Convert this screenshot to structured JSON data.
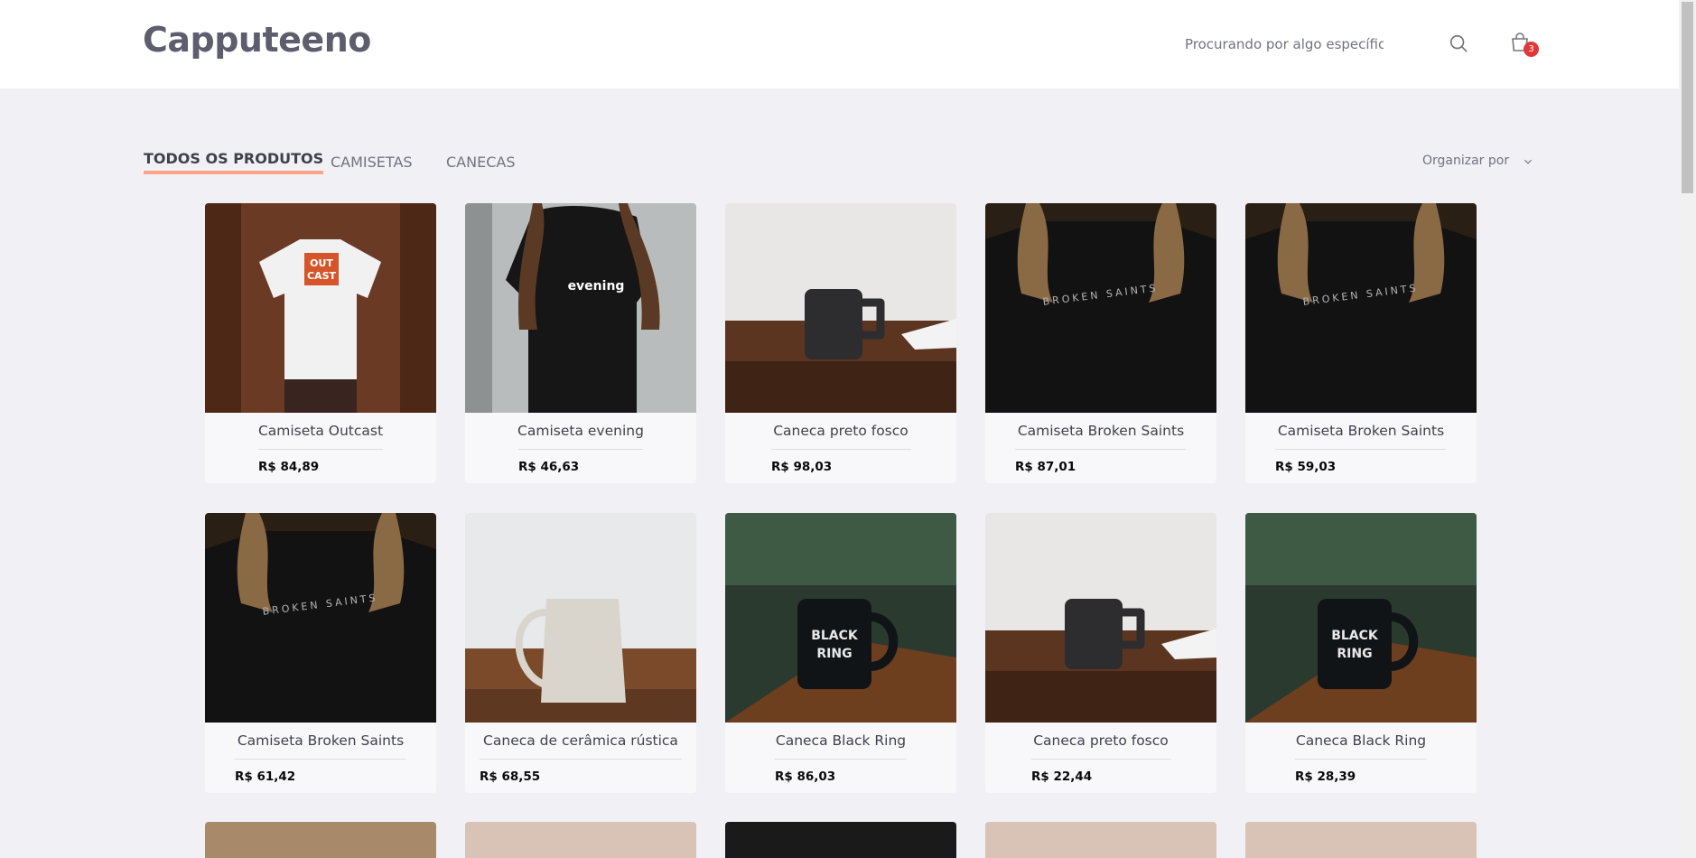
{
  "header": {
    "logo": "Capputeeno",
    "search_placeholder": "Procurando por algo específico?",
    "cart_count": "3"
  },
  "tabs": [
    {
      "label": "TODOS OS PRODUTOS",
      "active": true
    },
    {
      "label": "CAMISETAS",
      "active": false
    },
    {
      "label": "CANECAS",
      "active": false
    }
  ],
  "sort": {
    "label": "Organizar por"
  },
  "products": [
    {
      "name": "Camiseta Outcast",
      "price": "R$ 84,89",
      "image": "tshirt-outcast"
    },
    {
      "name": "Camiseta evening",
      "price": "R$ 46,63",
      "image": "tshirt-evening"
    },
    {
      "name": "Caneca preto fosco",
      "price": "R$ 98,03",
      "image": "mug-black-matte"
    },
    {
      "name": "Camiseta Broken Saints",
      "price": "R$ 87,01",
      "image": "tshirt-broken-saints"
    },
    {
      "name": "Camiseta Broken Saints",
      "price": "R$ 59,03",
      "image": "tshirt-broken-saints"
    },
    {
      "name": "Camiseta Broken Saints",
      "price": "R$ 61,42",
      "image": "tshirt-broken-saints"
    },
    {
      "name": "Caneca de cerâmica rústica",
      "price": "R$ 68,55",
      "image": "mug-ceramic-rustic"
    },
    {
      "name": "Caneca Black Ring",
      "price": "R$ 86,03",
      "image": "mug-black-ring"
    },
    {
      "name": "Caneca preto fosco",
      "price": "R$ 22,44",
      "image": "mug-black-matte"
    },
    {
      "name": "Caneca Black Ring",
      "price": "R$ 28,39",
      "image": "mug-black-ring"
    }
  ],
  "colors": {
    "background": "#f0f0f5",
    "accent_underline": "#ffa585",
    "badge": "#de3838",
    "text_primary": "#41414d",
    "text_secondary": "#737380"
  }
}
